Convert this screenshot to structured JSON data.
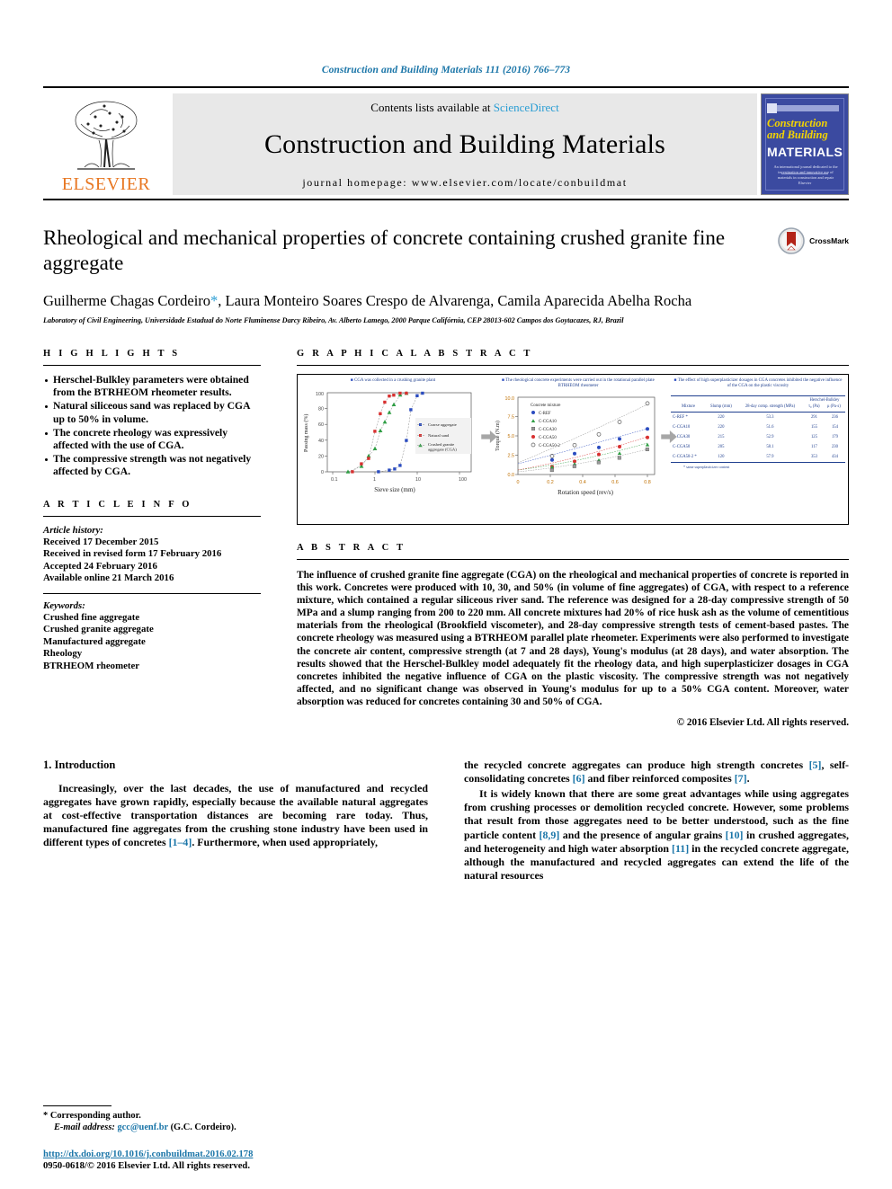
{
  "running_head": "Construction and Building Materials 111 (2016) 766–773",
  "masthead": {
    "contents_line": "Contents lists available at",
    "sciencedirect": "ScienceDirect",
    "journal_name": "Construction and Building Materials",
    "homepage": "journal homepage: www.elsevier.com/locate/conbuildmat",
    "publisher": "ELSEVIER",
    "cover": {
      "line1": "Construction",
      "line2": "and Building",
      "line3": "MATERIALS",
      "blurb": "An international journal dedicated to the investigation and innovative use of materials in construction and repair",
      "footer": "Elsevier"
    }
  },
  "article": {
    "title": "Rheological and mechanical properties of concrete containing crushed granite fine aggregate",
    "crossmark_label": "CrossMark",
    "authors": "Guilherme Chagas Cordeiro",
    "author_star": "*",
    "authors_rest": ", Laura Monteiro Soares Crespo de Alvarenga, Camila Aparecida Abelha Rocha",
    "affiliation": "Laboratory of Civil Engineering, Universidade Estadual do Norte Fluminense Darcy Ribeiro, Av. Alberto Lamego, 2000 Parque Califórnia, CEP 28013-602 Campos dos Goytacazes, RJ, Brazil"
  },
  "highlights": {
    "heading": "H I G H L I G H T S",
    "items": [
      "Herschel-Bulkley parameters were obtained from the BTRHEOM rheometer results.",
      "Natural siliceous sand was replaced by CGA up to 50% in volume.",
      "The concrete rheology was expressively affected with the use of CGA.",
      "The compressive strength was not negatively affected by CGA."
    ]
  },
  "article_info": {
    "heading": "A R T I C L E   I N F O",
    "history_label": "Article history:",
    "history": [
      "Received 17 December 2015",
      "Received in revised form 17 February 2016",
      "Accepted 24 February 2016",
      "Available online 21 March 2016"
    ],
    "keywords_label": "Keywords:",
    "keywords": [
      "Crushed fine aggregate",
      "Crushed granite aggregate",
      "Manufactured aggregate",
      "Rheology",
      "BTRHEOM rheometer"
    ]
  },
  "graphical_abstract": {
    "heading": "G R A P H I C A L   A B S T R A C T",
    "panel1_caption": "CGA was collected in a crushing granite plant",
    "panel2_caption": "The rheological concrete experiments were carried out in the rotational parallel plate BTRHEOM rheometer",
    "panel3_caption": "The effect of high superplasticizer dosages in CGA concretes inhibited the negative influence of the CGA on the plastic viscosity",
    "table": {
      "headers": [
        "Mixture",
        "Slump (mm)",
        "28-day comp. strength (MPa)",
        "Herschel-Bulkley"
      ],
      "subheaders": [
        "τ₀ (Pa)",
        "μ (Pa·s)"
      ],
      "rows": [
        {
          "mixture": "C-REF *",
          "slump": "220",
          "strength": "53.3",
          "tau0": "291",
          "mu": "236"
        },
        {
          "mixture": "C-CGA10",
          "slump": "220",
          "strength": "51.6",
          "tau0": "155",
          "mu": "154"
        },
        {
          "mixture": "C-CGA30",
          "slump": "215",
          "strength": "52.9",
          "tau0": "125",
          "mu": "179"
        },
        {
          "mixture": "C-CGA50",
          "slump": "205",
          "strength": "58.1",
          "tau0": "117",
          "mu": "230"
        },
        {
          "mixture": "C-CGA50-2 *",
          "slump": "120",
          "strength": "57.9",
          "tau0": "353",
          "mu": "434"
        }
      ],
      "note": "* same superplasticizer content"
    }
  },
  "chart_data": [
    {
      "type": "scatter",
      "title": "",
      "xlabel": "Sieve size (mm)",
      "ylabel": "Passing mass (%)",
      "xscale": "log",
      "xticks": [
        "0.1",
        "1",
        "10",
        "100"
      ],
      "yticks": [
        "0",
        "20",
        "40",
        "60",
        "80",
        "100"
      ],
      "ylim": [
        0,
        100
      ],
      "legend_position": "right",
      "series": [
        {
          "name": "Coarse aggregate",
          "color": "#2b4cc0",
          "x": [
            1.2,
            2.4,
            3.4,
            4.8,
            6.4,
            7.6,
            9.6,
            12.5
          ],
          "y": [
            0,
            2,
            3.5,
            8,
            40,
            78,
            97,
            100
          ]
        },
        {
          "name": "Natural sand",
          "color": "#d83030",
          "x": [
            0.18,
            0.3,
            0.42,
            0.6,
            0.85,
            1.2,
            1.7,
            2.4,
            3.4,
            4.8
          ],
          "y": [
            0,
            10,
            17,
            51,
            73,
            88,
            96,
            97,
            100,
            100
          ]
        },
        {
          "name": "Crushed granite aggregate (CGA)",
          "color": "#2f9e44",
          "x": [
            0.15,
            0.3,
            0.42,
            0.6,
            0.85,
            1.2,
            1.7,
            2.4,
            3.4,
            4.8
          ],
          "y": [
            0,
            7,
            20,
            35,
            52,
            63,
            75,
            85,
            97,
            100
          ]
        }
      ]
    },
    {
      "type": "scatter",
      "title": "Concrete mixture",
      "xlabel": "Rotation speed (rev/s)",
      "ylabel": "Torque (N.m)",
      "xticks": [
        "0",
        "0.2",
        "0.4",
        "0.6",
        "0.8"
      ],
      "yticks": [
        "0.0",
        "2.5",
        "5.0",
        "7.5",
        "10.0"
      ],
      "ylim": [
        0,
        10
      ],
      "xlim": [
        0,
        0.85
      ],
      "legend_position": "inside-top-left",
      "series": [
        {
          "name": "C-REF",
          "color": "#2b4cc0",
          "marker": "circle",
          "x": [
            0.21,
            0.35,
            0.5,
            0.63,
            0.8
          ],
          "y": [
            1.9,
            2.7,
            3.5,
            4.6,
            5.9
          ]
        },
        {
          "name": "C-CGA10",
          "color": "#2f9e44",
          "marker": "triangle",
          "x": [
            0.21,
            0.35,
            0.5,
            0.63,
            0.8
          ],
          "y": [
            0.9,
            1.5,
            2.0,
            2.9,
            4.0
          ]
        },
        {
          "name": "C-CGA30",
          "color": "#808080",
          "marker": "square",
          "x": [
            0.21,
            0.35,
            0.5,
            0.63,
            0.8
          ],
          "y": [
            0.5,
            1.0,
            1.5,
            2.1,
            3.2
          ]
        },
        {
          "name": "C-CGA50",
          "color": "#d83030",
          "marker": "circle",
          "x": [
            0.21,
            0.35,
            0.5,
            0.63,
            0.8
          ],
          "y": [
            1.0,
            1.7,
            2.6,
            3.6,
            4.8
          ]
        },
        {
          "name": "C-CGA50-2",
          "color": "#666666",
          "marker": "open-circle",
          "x": [
            0.21,
            0.35,
            0.5,
            0.63,
            0.8
          ],
          "y": [
            2.4,
            3.8,
            5.2,
            6.8,
            9.2
          ]
        }
      ]
    }
  ],
  "abstract": {
    "heading": "A B S T R A C T",
    "text": "The influence of crushed granite fine aggregate (CGA) on the rheological and mechanical properties of concrete is reported in this work. Concretes were produced with 10, 30, and 50% (in volume of fine aggregates) of CGA, with respect to a reference mixture, which contained a regular siliceous river sand. The reference was designed for a 28-day compressive strength of 50 MPa and a slump ranging from 200 to 220 mm. All concrete mixtures had 20% of rice husk ash as the volume of cementitious materials from the rheological (Brookfield viscometer), and 28-day compressive strength tests of cement-based pastes. The concrete rheology was measured using a BTRHEOM parallel plate rheometer. Experiments were also performed to investigate the concrete air content, compressive strength (at 7 and 28 days), Young's modulus (at 28 days), and water absorption. The results showed that the Herschel-Bulkley model adequately fit the rheology data, and high superplasticizer dosages in CGA concretes inhibited the negative influence of CGA on the plastic viscosity. The compressive strength was not negatively affected, and no significant change was observed in Young's modulus for up to a 50% CGA content. Moreover, water absorption was reduced for concretes containing 30 and 50% of CGA.",
    "copyright": "© 2016 Elsevier Ltd. All rights reserved."
  },
  "introduction": {
    "heading": "1. Introduction",
    "left_para1_a": "Increasingly, over the last decades, the use of manufactured and recycled aggregates have grown rapidly, especially because the available natural aggregates at cost-effective transportation distances are becoming rare today. Thus, manufactured fine aggregates from the crushing stone industry have been used in different types of concretes ",
    "left_ref1": "[1–4]",
    "left_para1_b": ". Furthermore, when used appropriately,",
    "right_para1_a": "the recycled concrete aggregates can produce high strength concretes ",
    "right_ref1": "[5]",
    "right_para1_b": ", self-consolidating concretes ",
    "right_ref2": "[6]",
    "right_para1_c": " and fiber reinforced composites ",
    "right_ref3": "[7]",
    "right_para1_d": ".",
    "right_para2_a": "It is widely known that there are some great advantages while using aggregates from crushing processes or demolition recycled concrete. However, some problems that result from those aggregates need to be better understood, such as the fine particle content ",
    "right_ref4": "[8,9]",
    "right_para2_b": " and the presence of angular grains ",
    "right_ref5": "[10]",
    "right_para2_c": " in crushed aggregates, and heterogeneity and high water absorption ",
    "right_ref6": "[11]",
    "right_para2_d": " in the recycled concrete aggregate, although the manufactured and recycled aggregates can extend the life of the natural resources"
  },
  "footer": {
    "corresponding_marker": "*",
    "corresponding_label": "Corresponding author.",
    "email_label": "E-mail address:",
    "email": "gcc@uenf.br",
    "email_suffix": "(G.C. Cordeiro).",
    "doi": "http://dx.doi.org/10.1016/j.conbuildmat.2016.02.178",
    "issn_line": "0950-0618/© 2016 Elsevier Ltd. All rights reserved."
  }
}
